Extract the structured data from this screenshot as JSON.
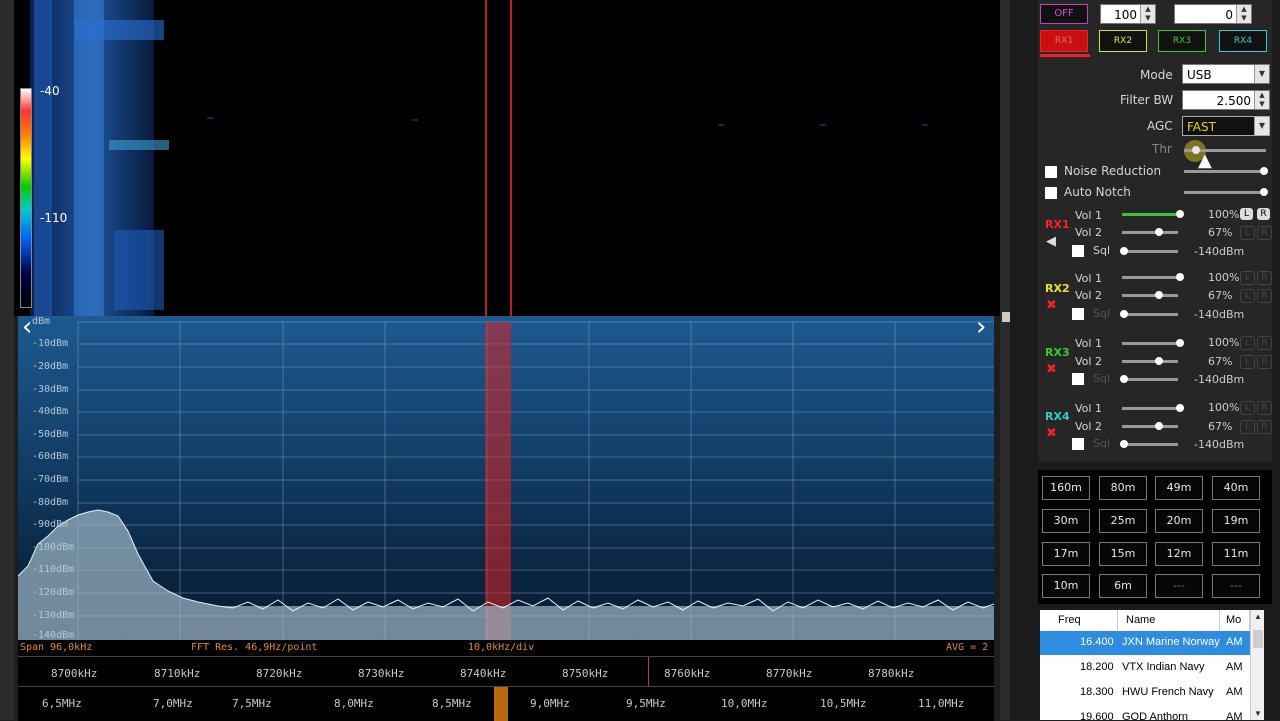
{
  "top_controls": {
    "off_label": "OFF",
    "field1_value": "100",
    "field2_value": "0"
  },
  "receivers": [
    "RX1",
    "RX2",
    "RX3",
    "RX4"
  ],
  "receiver_colors": {
    "RX1": "#ff2020",
    "RX2": "#e6e62a",
    "RX3": "#33cc33",
    "RX4": "#33cccc"
  },
  "dsp": {
    "mode_label": "Mode",
    "mode_value": "USB",
    "filter_label": "Filter BW",
    "filter_value": "2.500",
    "agc_label": "AGC",
    "agc_value": "FAST",
    "thr_label": "Thr",
    "noise_reduction": "Noise Reduction",
    "auto_notch": "Auto Notch"
  },
  "audio": {
    "vol1": "Vol 1",
    "vol2": "Vol 2",
    "sql": "Sql",
    "rx1_vol1_pct": "100%",
    "rx1_vol2_pct": "67%",
    "rx1_sql": "-140dBm",
    "rx2_vol1_pct": "100%",
    "rx2_vol2_pct": "67%",
    "rx2_sql": "-140dBm",
    "rx3_vol1_pct": "100%",
    "rx3_vol2_pct": "67%",
    "rx3_sql": "-140dBm",
    "rx4_vol1_pct": "100%",
    "rx4_vol2_pct": "67%",
    "rx4_sql": "-140dBm",
    "l": "L",
    "r": "R"
  },
  "bands": [
    "160m",
    "80m",
    "49m",
    "40m",
    "30m",
    "25m",
    "20m",
    "19m",
    "17m",
    "15m",
    "12m",
    "11m",
    "10m",
    "6m",
    "---",
    "---"
  ],
  "freq_table": {
    "headers": [
      "Freq",
      "Name",
      "Mo"
    ],
    "rows": [
      {
        "freq": "16.400",
        "name": "JXN Marine Norway",
        "mode": "AM"
      },
      {
        "freq": "18.200",
        "name": "VTX Indian Navy",
        "mode": "AM"
      },
      {
        "freq": "18.300",
        "name": "HWU French Navy",
        "mode": "AM"
      },
      {
        "freq": "19.600",
        "name": "GQD Anthorn",
        "mode": "AM"
      }
    ]
  },
  "waterfall": {
    "label_top": "-40",
    "label_bottom": "-110"
  },
  "spectrum": {
    "db_labels": [
      "dBm",
      "-10dBm",
      "-20dBm",
      "-30dBm",
      "-40dBm",
      "-50dBm",
      "-60dBm",
      "-70dBm",
      "-80dBm",
      "-90dBm",
      "-100dBm",
      "-110dBm",
      "-120dBm",
      "-130dBm",
      "-140dBm"
    ]
  },
  "status": {
    "span": "Span 96,0kHz",
    "fft": "FFT Res. 46,9Hz/point",
    "div": "10,0kHz/div",
    "avg": "AVG = 2"
  },
  "ruler_fine": [
    "8700kHz",
    "8710kHz",
    "8720kHz",
    "8730kHz",
    "8740kHz",
    "8750kHz",
    "8760kHz",
    "8770kHz",
    "8780kHz"
  ],
  "ruler_coarse": [
    "6,5MHz",
    "7,0MHz",
    "7,5MHz",
    "8,0MHz",
    "8,5MHz",
    "9,0MHz",
    "9,5MHz",
    "10,0MHz",
    "10,5MHz",
    "11,0MHz"
  ]
}
